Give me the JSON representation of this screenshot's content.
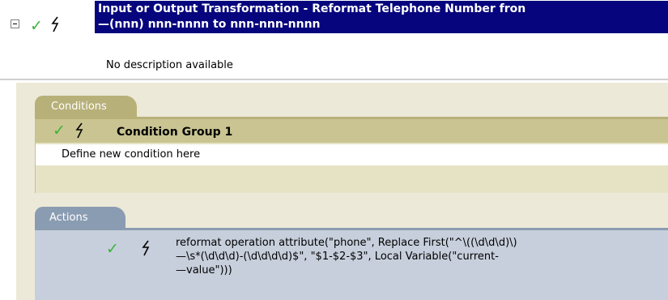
{
  "rule": {
    "title_line1": "Input or Output Transformation - Reformat Telephone Number fron",
    "title_line2": "—(nnn) nnn-nnnn to nnn-nnn-nnnn",
    "description": "No description available"
  },
  "conditions": {
    "tab_label": "Conditions",
    "group_label": "Condition Group 1",
    "define_text": "Define new condition here"
  },
  "actions": {
    "tab_label": "Actions",
    "line1": "reformat operation attribute(\"phone\", Replace First(\"^\\((\\d\\d\\d)\\)",
    "line2": "—\\s*(\\d\\d\\d)-(\\d\\d\\d\\d)$\", \"$1-$2-$3\", Local Variable(\"current-",
    "line3": "—value\")))"
  },
  "colors": {
    "title_bg": "#06057d",
    "check": "#3cb43c",
    "conditions_tab": "#b7b079",
    "actions_tab": "#8a9cb2"
  },
  "icons": [
    "collapse-icon",
    "check-icon",
    "lightning-icon"
  ]
}
